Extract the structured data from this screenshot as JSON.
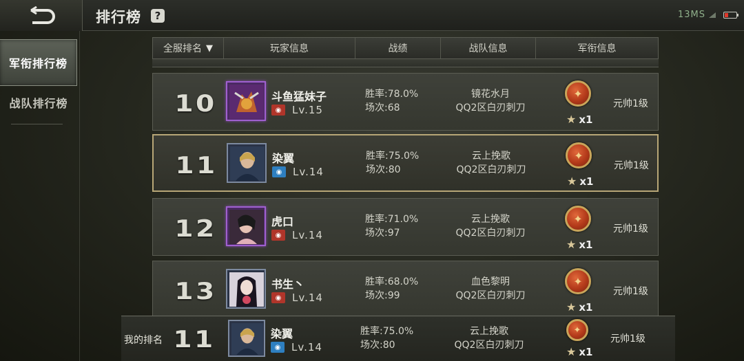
{
  "header": {
    "title": "排行榜",
    "help": "?",
    "status_text": "13MS"
  },
  "sidebar": {
    "items": [
      {
        "label": "军衔排行榜",
        "active": true
      },
      {
        "label": "战队排行榜",
        "active": false
      }
    ]
  },
  "table": {
    "columns": [
      "全服排名",
      "玩家信息",
      "战绩",
      "战队信息",
      "军衔信息"
    ],
    "sort_indicator": "▼",
    "rows": [
      {
        "rank": "10",
        "name": "斗鱼猛妹子",
        "camp": "red",
        "level": "Lv.15",
        "win_rate": "胜率:78.0%",
        "matches": "场次:68",
        "team_name": "镜花水月",
        "team_server": "QQ2区白刃刺刀",
        "stars": "x1",
        "rank_title": "元帅1级",
        "avatar_frame": "purple"
      },
      {
        "rank": "11",
        "name": "染翼",
        "camp": "blue",
        "level": "Lv.14",
        "win_rate": "胜率:75.0%",
        "matches": "场次:80",
        "team_name": "云上挽歌",
        "team_server": "QQ2区白刃刺刀",
        "stars": "x1",
        "rank_title": "元帅1级",
        "avatar_frame": "blue",
        "highlight": true
      },
      {
        "rank": "12",
        "name": "虎口",
        "camp": "red",
        "level": "Lv.14",
        "win_rate": "胜率:71.0%",
        "matches": "场次:97",
        "team_name": "云上挽歌",
        "team_server": "QQ2区白刃刺刀",
        "stars": "x1",
        "rank_title": "元帅1级",
        "avatar_frame": "purple"
      },
      {
        "rank": "13",
        "name": "书生丶",
        "camp": "red",
        "level": "Lv.14",
        "win_rate": "胜率:68.0%",
        "matches": "场次:99",
        "team_name": "血色黎明",
        "team_server": "QQ2区白刃刺刀",
        "stars": "x1",
        "rank_title": "元帅1级",
        "avatar_frame": "blue"
      }
    ]
  },
  "my_rank": {
    "label": "我的排名",
    "rank": "11",
    "name": "染翼",
    "camp": "blue",
    "level": "Lv.14",
    "win_rate": "胜率:75.0%",
    "matches": "场次:80",
    "team_name": "云上挽歌",
    "team_server": "QQ2区白刃刺刀",
    "stars": "x1",
    "rank_title": "元帅1级"
  },
  "icons": {
    "back": "back-arrow-icon",
    "help": "question-icon",
    "medal": "marshal-medal-icon",
    "star": "star-icon",
    "camp": "camp-badge-icon"
  },
  "colors": {
    "highlight_border": "#b8a777",
    "camp_red": "#b0352a",
    "camp_blue": "#2e7fc0",
    "medal": "#b33a1a"
  }
}
